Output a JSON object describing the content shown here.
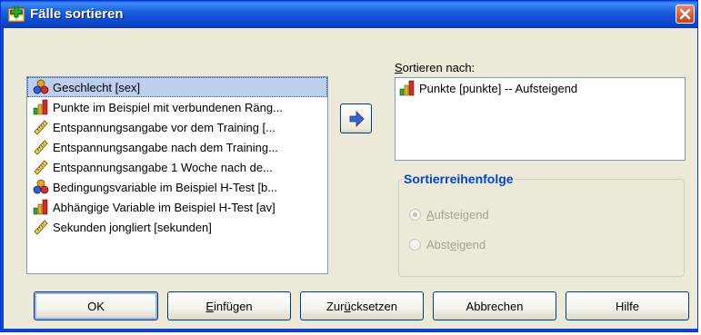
{
  "window": {
    "title": "Fälle sortieren",
    "app_icon": "spss-dialog-icon",
    "close_icon": "close-icon"
  },
  "source_list": {
    "items": [
      {
        "label": "Geschlecht [sex]",
        "icon": "nominal-variable-icon",
        "selected": true
      },
      {
        "label": "Punkte im Beispiel mit verbundenen Räng...",
        "icon": "ordinal-variable-icon",
        "selected": false
      },
      {
        "label": "Entspannungsangabe vor dem Training [...",
        "icon": "scale-variable-icon",
        "selected": false
      },
      {
        "label": "Entspannungsangabe nach dem Training...",
        "icon": "scale-variable-icon",
        "selected": false
      },
      {
        "label": "Entspannungsangabe 1 Woche nach de...",
        "icon": "scale-variable-icon",
        "selected": false
      },
      {
        "label": "Bedingungsvariable im Beispiel H-Test [b...",
        "icon": "nominal-variable-icon",
        "selected": false
      },
      {
        "label": "Abhängige Variable im Beispiel H-Test [av]",
        "icon": "ordinal-variable-icon",
        "selected": false
      },
      {
        "label": "Sekunden jongliert [sekunden]",
        "icon": "scale-variable-icon",
        "selected": false
      }
    ]
  },
  "move_button": {
    "icon": "arrow-right-icon"
  },
  "sort_by": {
    "label_prefix": "S",
    "label_rest": "ortieren nach:",
    "items": [
      {
        "label": "Punkte [punkte] -- Aufsteigend",
        "icon": "ordinal-variable-icon"
      }
    ]
  },
  "sort_order": {
    "title": "Sortierreihenfolge",
    "options": [
      {
        "prefix": "",
        "mnemonic": "A",
        "rest": "ufsteigend",
        "checked": true
      },
      {
        "prefix": "Abst",
        "mnemonic": "e",
        "rest": "igend",
        "checked": false
      }
    ]
  },
  "buttons": {
    "ok": "OK",
    "paste_mnemonic": "E",
    "paste_rest": "infügen",
    "reset_prefix": "Zur",
    "reset_mnemonic": "ü",
    "reset_rest": "cksetzen",
    "cancel": "Abbrechen",
    "help": "Hilfe"
  }
}
